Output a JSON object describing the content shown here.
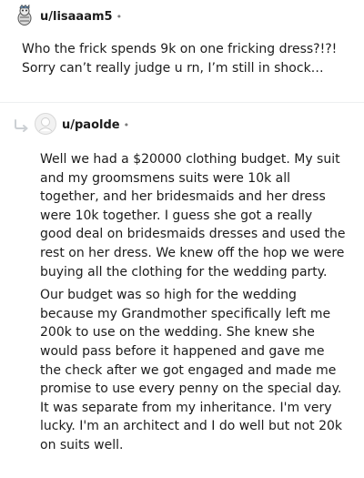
{
  "parent_comment": {
    "username": "u/lisaaam5",
    "separator_dot": "•",
    "text": "Who the frick spends 9k on one fricking dress?!?!\nSorry can’t really judge u rn, I’m still in shock…",
    "avatar_icon": "snoo-avatar-icon"
  },
  "reply_comment": {
    "username": "u/paolde",
    "separator_dot": "•",
    "thread_icon": "reply-arrow-icon",
    "avatar_icon": "default-avatar-icon",
    "paragraphs": [
      "Well we had a $20000 clothing budget. My suit and my groomsmens suits were 10k all together, and her bridesmaids and her dress were 10k together. I guess she got a really good deal on bridesmaids dresses and used the rest on her dress. We knew off the hop we were buying all the clothing for the wedding party.",
      "Our budget was so high for the wedding because my Grandmother specifically left me 200k to use on the wedding. She knew she would pass before it happened and gave me the check after we got engaged and made me promise to use every penny on the special day. It was separate from my inheritance. I'm very lucky. I'm an architect and I do well but not 20k on suits well."
    ]
  },
  "colors": {
    "text": "#1c1c1c",
    "meta": "#7c7c7c",
    "divider": "#edeff1",
    "thread_line": "#ccd0d4"
  }
}
